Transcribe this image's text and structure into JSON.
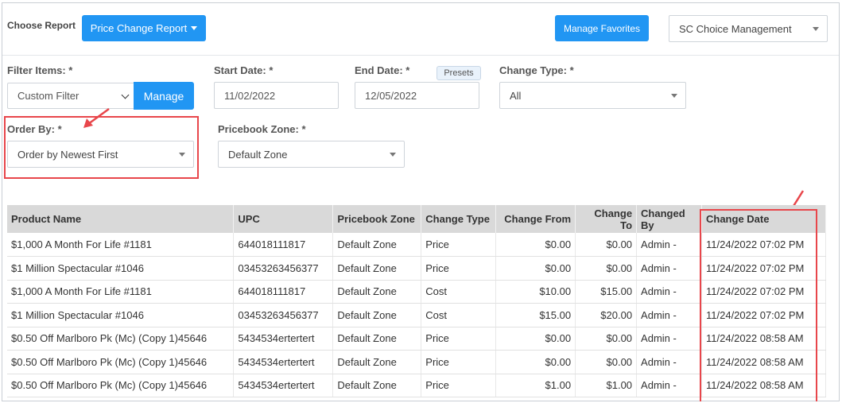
{
  "toolbar": {
    "choose_report_label": "Choose Report",
    "report_button_label": "Price Change Report",
    "manage_favorites_label": "Manage Favorites",
    "store_select_value": "SC Choice Management"
  },
  "filters": {
    "filter_items_label": "Filter Items: *",
    "filter_items_value": "Custom Filter",
    "manage_label": "Manage",
    "start_date_label": "Start Date: *",
    "start_date_value": "11/02/2022",
    "end_date_label": "End Date: *",
    "end_date_value": "12/05/2022",
    "presets_label": "Presets",
    "change_type_label": "Change Type: *",
    "change_type_value": "All",
    "order_by_label": "Order By: *",
    "order_by_value": "Order by Newest First",
    "pricebook_zone_label": "Pricebook Zone: *",
    "pricebook_zone_value": "Default Zone"
  },
  "table": {
    "headers": [
      "Product Name",
      "UPC",
      "Pricebook Zone",
      "Change Type",
      "Change From",
      "Change To",
      "Changed By",
      "Change Date"
    ],
    "rows": [
      [
        "$1,000 A Month For Life #1181",
        "644018111817",
        "Default Zone",
        "Price",
        "$0.00",
        "$0.00",
        "Admin -",
        "11/24/2022 07:02 PM"
      ],
      [
        "$1 Million Spectacular #1046",
        "03453263456377",
        "Default Zone",
        "Price",
        "$0.00",
        "$0.00",
        "Admin -",
        "11/24/2022 07:02 PM"
      ],
      [
        "$1,000 A Month For Life #1181",
        "644018111817",
        "Default Zone",
        "Cost",
        "$10.00",
        "$15.00",
        "Admin -",
        "11/24/2022 07:02 PM"
      ],
      [
        "$1 Million Spectacular #1046",
        "03453263456377",
        "Default Zone",
        "Cost",
        "$15.00",
        "$20.00",
        "Admin -",
        "11/24/2022 07:02 PM"
      ],
      [
        "$0.50 Off Marlboro Pk (Mc) (Copy 1)45646",
        "5434534ertertert",
        "Default Zone",
        "Price",
        "$0.00",
        "$0.00",
        "Admin -",
        "11/24/2022 08:58 AM"
      ],
      [
        "$0.50 Off Marlboro Pk (Mc) (Copy 1)45646",
        "5434534ertertert",
        "Default Zone",
        "Price",
        "$0.00",
        "$0.00",
        "Admin -",
        "11/24/2022 08:58 AM"
      ],
      [
        "$0.50 Off Marlboro Pk (Mc) (Copy 1)45646",
        "5434534ertertert",
        "Default Zone",
        "Price",
        "$1.00",
        "$1.00",
        "Admin -",
        "11/24/2022 08:58 AM"
      ]
    ]
  },
  "colors": {
    "primary": "#2196f3",
    "highlight": "#e8464b",
    "header_bg": "#d9d9d9"
  }
}
